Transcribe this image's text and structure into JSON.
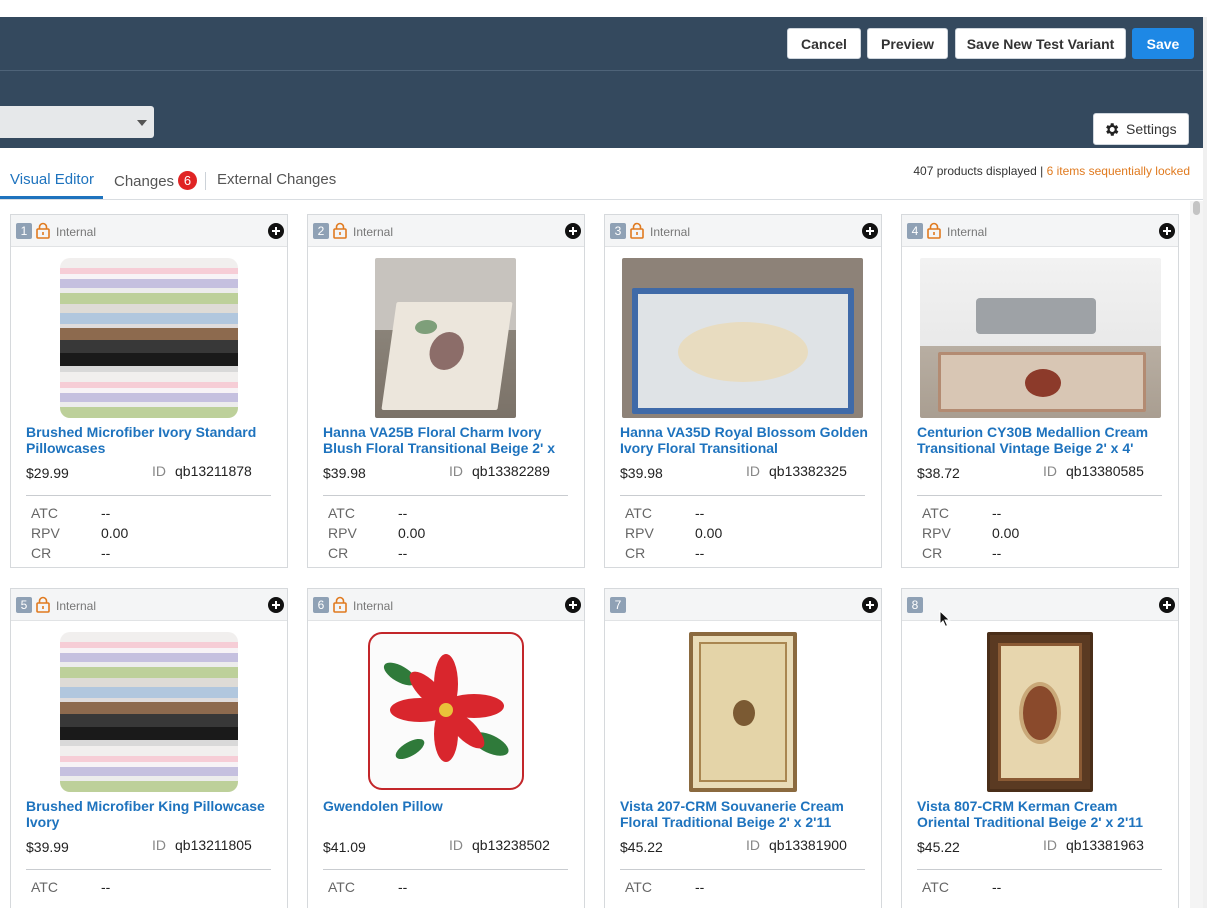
{
  "header": {
    "buttons": {
      "cancel": "Cancel",
      "preview": "Preview",
      "save_variant": "Save New Test Variant",
      "save": "Save"
    },
    "settings_label": "Settings",
    "colors": {
      "bg": "#34495e",
      "primary": "#1e88e5"
    }
  },
  "tabs": {
    "visual_editor": "Visual Editor",
    "changes": "Changes",
    "changes_count": "6",
    "external_changes": "External Changes",
    "active": "visual_editor"
  },
  "summary": {
    "products_displayed": "407 products displayed",
    "separator": "|",
    "locked": "6 items sequentially locked"
  },
  "metric_labels": {
    "atc": "ATC",
    "rpv": "RPV",
    "cr": "CR"
  },
  "id_label": "ID",
  "products": [
    {
      "position": "1",
      "locked": true,
      "tag": "Internal",
      "title": "Brushed Microfiber Ivory Standard Pillowcases",
      "price": "$29.99",
      "id": "qb13211878",
      "atc": "--",
      "rpv": "0.00",
      "cr": "--",
      "image": "pillowcase-stack"
    },
    {
      "position": "2",
      "locked": true,
      "tag": "Internal",
      "title": "Hanna VA25B Floral Charm Ivory Blush Floral Transitional Beige 2' x",
      "price": "$39.98",
      "id": "qb13382289",
      "atc": "--",
      "rpv": "0.00",
      "cr": "--",
      "image": "floral-rug-room"
    },
    {
      "position": "3",
      "locked": true,
      "tag": "Internal",
      "title": "Hanna VA35D Royal Blossom Golden Ivory Floral Transitional",
      "price": "$39.98",
      "id": "qb13382325",
      "atc": "--",
      "rpv": "0.00",
      "cr": "--",
      "image": "blossom-rug-room"
    },
    {
      "position": "4",
      "locked": true,
      "tag": "Internal",
      "title": "Centurion CY30B Medallion Cream Transitional Vintage Beige 2' x 4'",
      "price": "$38.72",
      "id": "qb13380585",
      "atc": "--",
      "rpv": "0.00",
      "cr": "--",
      "image": "medallion-rug-room"
    },
    {
      "position": "5",
      "locked": true,
      "tag": "Internal",
      "title": "Brushed Microfiber King Pillowcase Ivory",
      "price": "$39.99",
      "id": "qb13211805",
      "atc": "--",
      "image": "pillowcase-stack"
    },
    {
      "position": "6",
      "locked": true,
      "tag": "Internal",
      "title": "Gwendolen Pillow",
      "price": "$41.09",
      "id": "qb13238502",
      "atc": "--",
      "image": "poinsettia-pillow"
    },
    {
      "position": "7",
      "locked": false,
      "tag": "",
      "title": "Vista 207-CRM Souvanerie Cream Floral Traditional Beige 2' x 2'11",
      "price": "$45.22",
      "id": "qb13381900",
      "atc": "--",
      "image": "cream-rug"
    },
    {
      "position": "8",
      "locked": false,
      "tag": "",
      "title": "Vista 807-CRM Kerman Cream Oriental Traditional Beige 2' x 2'11",
      "price": "$45.22",
      "id": "qb13381963",
      "atc": "--",
      "image": "kerman-rug"
    }
  ],
  "icons": {
    "settings": "gear-icon",
    "lock": "lock-icon",
    "add": "plus-circle-icon",
    "dropdown": "caret-down-icon"
  }
}
